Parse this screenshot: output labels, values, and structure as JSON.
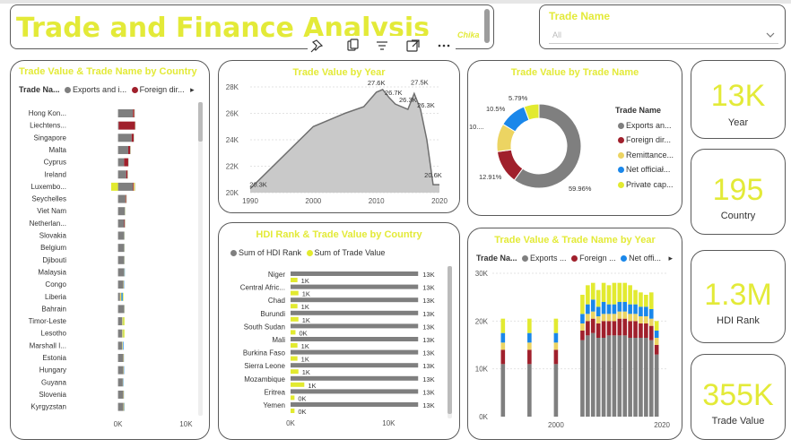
{
  "header": {
    "title": "Trade and Finance Analysis",
    "author": "Chika"
  },
  "visual_toolbar": {
    "icons": [
      "pin-icon",
      "copy-icon",
      "filter-icon",
      "focus-mode-icon",
      "more-options-icon"
    ],
    "more_label": "..."
  },
  "slicer": {
    "label": "Trade Name",
    "selected": "All"
  },
  "colors": {
    "exports": "#7f7f7f",
    "foreign_direct": "#a0202c",
    "remittance": "#ecd462",
    "net_official": "#1a87ea",
    "private_capital": "#e2ea30",
    "accent": "#e3ea38"
  },
  "panels": {
    "country_bars": {
      "title": "Trade Value & Trade Name by Country",
      "legend_title": "Trade Na...",
      "legend_items": [
        "Exports and i...",
        "Foreign dir..."
      ],
      "legend_arrow": "▸"
    },
    "year_area": {
      "title": "Trade Value by Year"
    },
    "donut": {
      "title": "Trade Value by Trade Name",
      "legend_title": "Trade Name",
      "legend_items": [
        "Exports an...",
        "Foreign dir...",
        "Remittance...",
        "Net officiał...",
        "Private cap..."
      ]
    },
    "hdi": {
      "title": "HDI Rank & Trade Value by Country",
      "legend_items": [
        "Sum of HDI Rank",
        "Sum of Trade Value"
      ]
    },
    "year_stack": {
      "title": "Trade Value & Trade Name by Year",
      "legend_title": "Trade Na...",
      "legend_items": [
        "Exports ...",
        "Foreign ...",
        "Net offi..."
      ],
      "legend_arrow": "▸"
    }
  },
  "kpis": [
    {
      "value": "13K",
      "label": "Year"
    },
    {
      "value": "195",
      "label": "Country"
    },
    {
      "value": "1.3M",
      "label": "HDI Rank"
    },
    {
      "value": "355K",
      "label": "Trade Value"
    }
  ],
  "chart_data": [
    {
      "type": "bar",
      "title": "Trade Value & Trade Name by Country",
      "categories": [
        "Hong Kon...",
        "Liechtens...",
        "Singapore",
        "Malta",
        "Cyprus",
        "Ireland",
        "Luxembo...",
        "Seychelles",
        "Viet Nam",
        "Netherlan...",
        "Slovakia",
        "Belgium",
        "Djibouti",
        "Malaysia",
        "Congo",
        "Liberia",
        "Bahrain",
        "Timor-Leste",
        "Lesotho",
        "Marshall I...",
        "Estonia",
        "Hungary",
        "Guyana",
        "Slovenia",
        "Kyrgyzstan"
      ],
      "series": [
        {
          "name": "Exports and i...",
          "values": [
            2200,
            100,
            2000,
            1500,
            900,
            1200,
            2200,
            1100,
            1000,
            900,
            900,
            900,
            900,
            900,
            800,
            300,
            900,
            600,
            600,
            600,
            800,
            800,
            700,
            800,
            800
          ]
        },
        {
          "name": "Foreign dir...",
          "values": [
            200,
            2400,
            300,
            300,
            600,
            200,
            100,
            100,
            0,
            100,
            0,
            0,
            0,
            0,
            0,
            0,
            0,
            0,
            0,
            0,
            0,
            0,
            0,
            0,
            0
          ]
        },
        {
          "name": "Remittance",
          "values": [
            50,
            50,
            50,
            50,
            50,
            50,
            200,
            50,
            50,
            50,
            50,
            50,
            50,
            50,
            50,
            200,
            50,
            100,
            100,
            100,
            50,
            50,
            50,
            50,
            100
          ]
        },
        {
          "name": "Net official",
          "values": [
            20,
            20,
            20,
            20,
            20,
            20,
            20,
            20,
            20,
            20,
            20,
            20,
            20,
            50,
            50,
            200,
            20,
            50,
            50,
            100,
            20,
            50,
            50,
            20,
            50
          ]
        },
        {
          "name": "Private cap...",
          "values": [
            0,
            0,
            0,
            0,
            0,
            0,
            -1000,
            0,
            0,
            0,
            0,
            0,
            0,
            0,
            0,
            100,
            0,
            200,
            200,
            0,
            0,
            0,
            0,
            0,
            0
          ]
        }
      ],
      "xticks": [
        "0K",
        "10K"
      ],
      "xlim": [
        -1000,
        11000
      ]
    },
    {
      "type": "area",
      "title": "Trade Value by Year",
      "x": [
        1990,
        2000,
        2005,
        2008,
        2010,
        2011,
        2012,
        2013,
        2015,
        2016,
        2017,
        2018,
        2019,
        2020
      ],
      "values": [
        20300,
        25000,
        26000,
        26500,
        27600,
        27800,
        27200,
        26700,
        26300,
        27500,
        26300,
        24000,
        20600,
        20600
      ],
      "xticks": [
        "1990",
        "2000",
        "2010",
        "2020"
      ],
      "yticks": [
        "20K",
        "22K",
        "24K",
        "26K",
        "28K"
      ],
      "ylim": [
        20000,
        28000
      ],
      "data_labels": [
        "20.3K",
        "27.6K",
        "26.7K",
        "26.3K",
        "27.5K",
        "26.3K",
        "20.6K"
      ]
    },
    {
      "type": "pie",
      "title": "Trade Value by Trade Name",
      "categories": [
        "Exports an...",
        "Foreign dir...",
        "Remittance...",
        "Net officiał...",
        "Private cap..."
      ],
      "values": [
        59.96,
        12.91,
        10.84,
        10.5,
        5.79
      ],
      "data_labels": [
        "59.96%",
        "12.91%",
        "10....",
        "10.5%",
        "5.79%"
      ]
    },
    {
      "type": "bar",
      "title": "HDI Rank & Trade Value by Country",
      "categories": [
        "Niger",
        "Central Afric...",
        "Chad",
        "Burundi",
        "South Sudan",
        "Mali",
        "Burkina Faso",
        "Sierra Leone",
        "Mozambique",
        "Eritrea",
        "Yemen"
      ],
      "series": [
        {
          "name": "Sum of HDI Rank",
          "values": [
            13000,
            13000,
            13000,
            13000,
            13000,
            13000,
            13000,
            13000,
            13000,
            13000,
            13000
          ],
          "labels": [
            "13K",
            "13K",
            "13K",
            "13K",
            "13K",
            "13K",
            "13K",
            "13K",
            "13K",
            "13K",
            "13K"
          ]
        },
        {
          "name": "Sum of Trade Value",
          "values": [
            700,
            800,
            700,
            800,
            500,
            700,
            700,
            800,
            1400,
            400,
            400
          ],
          "labels": [
            "1K",
            "1K",
            "1K",
            "1K",
            "0K",
            "1K",
            "1K",
            "1K",
            "1K",
            "0K",
            "0K"
          ]
        }
      ],
      "xticks": [
        "0K",
        "10K"
      ],
      "xlim": [
        0,
        17000
      ]
    },
    {
      "type": "bar",
      "title": "Trade Value & Trade Name by Year",
      "x": [
        1990,
        1995,
        2000,
        2005,
        2006,
        2007,
        2008,
        2009,
        2010,
        2011,
        2012,
        2013,
        2014,
        2015,
        2016,
        2017,
        2018,
        2019
      ],
      "series": [
        {
          "name": "Exports ...",
          "values": [
            11000,
            11000,
            11000,
            16000,
            17000,
            17500,
            16500,
            16500,
            17000,
            17000,
            17000,
            17000,
            16500,
            16500,
            16500,
            16500,
            16000,
            13000
          ]
        },
        {
          "name": "Foreign ...",
          "values": [
            3000,
            3000,
            3000,
            2000,
            3000,
            3000,
            3000,
            3500,
            3000,
            3000,
            3500,
            3500,
            3500,
            3500,
            3000,
            3000,
            3000,
            2000
          ]
        },
        {
          "name": "Remittance",
          "values": [
            1500,
            1500,
            1500,
            1500,
            1500,
            1500,
            1500,
            1500,
            1500,
            1500,
            1500,
            1500,
            1500,
            1500,
            1500,
            1500,
            1500,
            1500
          ]
        },
        {
          "name": "Net offi...",
          "values": [
            2000,
            2000,
            2000,
            2000,
            2000,
            2500,
            2000,
            2500,
            2000,
            2000,
            2000,
            2000,
            2000,
            2000,
            2000,
            2000,
            2000,
            1500
          ]
        },
        {
          "name": "Private",
          "values": [
            3000,
            3000,
            3000,
            4000,
            4000,
            3500,
            3500,
            4000,
            4000,
            4500,
            4000,
            4000,
            4000,
            3000,
            3000,
            2500,
            3500,
            2000
          ]
        }
      ],
      "xticks": [
        "2000",
        "2020"
      ],
      "yticks": [
        "0K",
        "10K",
        "20K",
        "30K"
      ],
      "ylim": [
        0,
        30000
      ]
    }
  ]
}
